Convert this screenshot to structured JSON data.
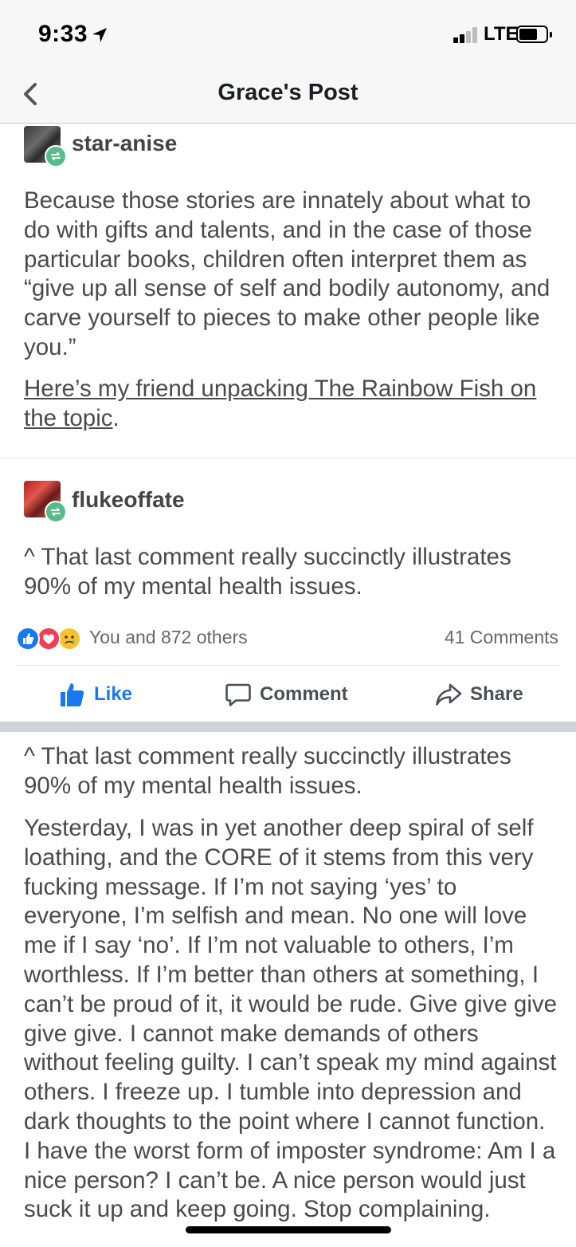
{
  "status_bar": {
    "time": "9:33",
    "network": "LTE",
    "icons": [
      "location-arrow-icon",
      "signal-icon",
      "battery-icon"
    ]
  },
  "nav": {
    "title": "Grace's Post",
    "back_icon": "chevron-left-icon"
  },
  "post": {
    "entries": [
      {
        "username": "star-anise",
        "text": "Because those stories are innately about what to do with gifts and talents, and in the case of those particular books, children often interpret them as “give up all sense of self and bodily autonomy, and carve yourself to pieces to make other people like you.”",
        "link_text": "Here’s my friend unpacking The Rainbow Fish on the topic",
        "link_suffix": "."
      },
      {
        "username": "flukeoffate",
        "text": "^ That last comment really succinctly illustrates 90% of my mental health issues."
      }
    ]
  },
  "reactions": {
    "summary": "You and 872 others",
    "comments": "41 Comments",
    "icons": [
      "like-reaction-icon",
      "love-reaction-icon",
      "sad-reaction-icon"
    ]
  },
  "actions": {
    "like": "Like",
    "comment": "Comment",
    "share": "Share"
  },
  "comment": {
    "quote": "^ That last comment really succinctly illustrates 90% of my mental health issues.",
    "body": "Yesterday, I was in yet another deep spiral of self loathing, and the CORE of it stems from this very fucking message. If I’m not saying ‘yes’ to everyone, I’m selfish and mean. No one will love me if I say ‘no’.  If I’m not valuable to others, I’m worthless.  If I’m better than others at something, I can’t be proud of it, it would be rude.  Give give give give give.  I cannot make demands of others without feeling guilty.  I can’t speak my mind against others.  I freeze up.  I tumble into depression and dark thoughts to the point where I cannot function. I have the worst form of imposter syndrome: Am I a nice person?  I can’t be. A nice person would just suck it up and keep going.  Stop complaining."
  },
  "colors": {
    "like_blue": "#1877f2",
    "love_red": "#f33e58",
    "reblog_green": "#56bc8a",
    "text_gray": "#4a4a4a"
  }
}
